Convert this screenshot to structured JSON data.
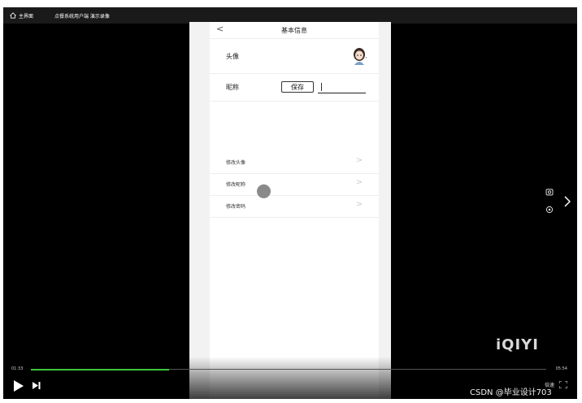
{
  "topbar": {
    "home_label": "主界面",
    "title": "点餐系统用户端 演示录像"
  },
  "phone": {
    "nav_title": "基本信息",
    "back_glyph": "<",
    "avatar_label": "头像",
    "nickname_label": "昵称",
    "save_button": "保存",
    "nickname_value": "",
    "menu": [
      {
        "label": "修改头像"
      },
      {
        "label": "修改昵称"
      },
      {
        "label": "修改密码"
      }
    ],
    "chevron": ">"
  },
  "player": {
    "time_current": "01:33",
    "time_total": "05:54",
    "progress": 0.268,
    "watermark": "iQIYI",
    "speed_label": "倍速",
    "progress_color": "#3cc53c"
  },
  "overlay": {
    "csdn_text": "CSDN @毕业设计703"
  },
  "icons": [
    "home-icon",
    "back-icon",
    "avatar-icon",
    "chevron-right-icon",
    "camera-icon",
    "location-icon",
    "next-arrow-icon",
    "play-icon",
    "next-icon",
    "fullscreen-icon"
  ]
}
